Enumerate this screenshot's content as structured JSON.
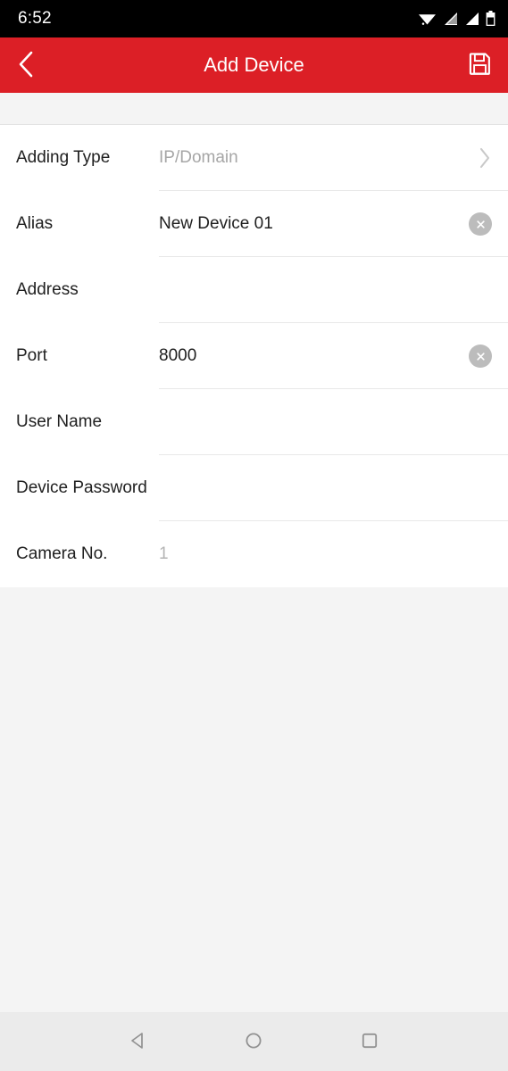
{
  "status_bar": {
    "time": "6:52",
    "icons": [
      "wifi-icon",
      "signal-icon",
      "signal-icon",
      "battery-icon"
    ]
  },
  "header": {
    "title": "Add Device",
    "back_icon": "chevron-left-icon",
    "save_icon": "save-floppy-icon"
  },
  "form": {
    "rows": [
      {
        "label": "Adding Type",
        "value": "IP/Domain",
        "value_state": "placeholder",
        "accessory": "chevron",
        "divider": true
      },
      {
        "label": "Alias",
        "value": "New Device 01",
        "value_state": "filled",
        "accessory": "clear",
        "divider": true
      },
      {
        "label": "Address",
        "value": "",
        "value_state": "empty",
        "accessory": "none",
        "divider": true
      },
      {
        "label": "Port",
        "value": "8000",
        "value_state": "filled",
        "accessory": "clear",
        "divider": true
      },
      {
        "label": "User Name",
        "value": "",
        "value_state": "empty",
        "accessory": "none",
        "divider": true
      },
      {
        "label": "Device Password",
        "value": "",
        "value_state": "empty",
        "accessory": "none",
        "divider": true
      },
      {
        "label": "Camera No.",
        "value": "1",
        "value_state": "dim",
        "accessory": "none",
        "divider": false
      }
    ]
  },
  "nav_bar": {
    "back_label": "back-triangle-icon",
    "home_label": "home-circle-icon",
    "recents_label": "recents-square-icon"
  },
  "colors": {
    "brand_red": "#dc1f26",
    "status_bar_bg": "#000000",
    "page_bg": "#f4f4f4",
    "panel_bg": "#ffffff",
    "divider": "#e8e8e8",
    "text_primary": "#202020",
    "text_placeholder": "#a6a6a6",
    "nav_bar_bg": "#ebebeb"
  }
}
